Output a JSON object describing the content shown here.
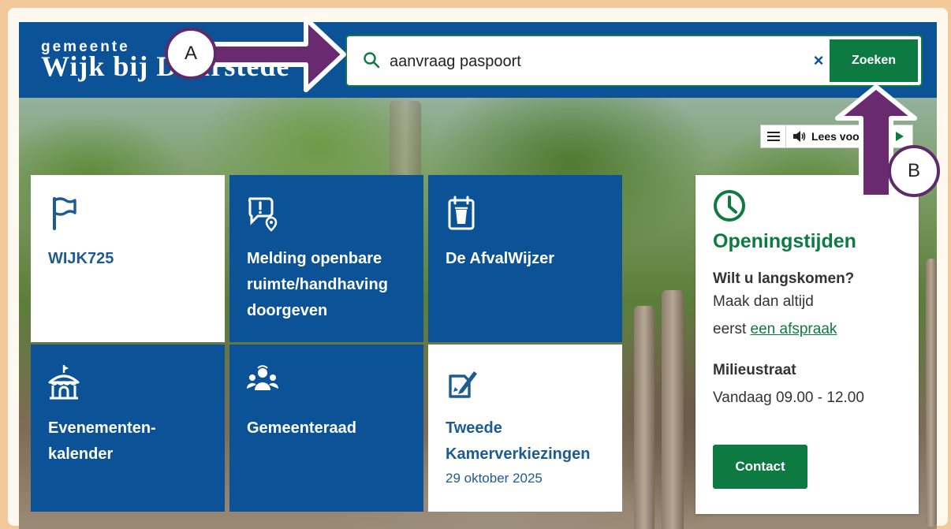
{
  "header": {
    "logo_small": "gemeente",
    "logo_main": "Wijk bij Duurstede",
    "search_value": "aanvraag paspoort",
    "clear_symbol": "×",
    "search_button": "Zoeken"
  },
  "readspeaker": {
    "label": "Lees voor"
  },
  "tiles": [
    {
      "label": "WIJK725",
      "icon": "flag-icon"
    },
    {
      "label": "Melding openbare\nruimte/handhaving\ndoorgeven",
      "icon": "report-location-icon"
    },
    {
      "label": "De AfvalWijzer",
      "icon": "waste-calendar-icon"
    },
    {
      "label": "Evenementen-\nkalender",
      "icon": "tent-icon"
    },
    {
      "label": "Gemeenteraad",
      "icon": "council-people-icon"
    },
    {
      "label": "Tweede\nKamerverkiezingen",
      "sub": "29 oktober 2025",
      "icon": "ballot-pen-icon"
    }
  ],
  "hours": {
    "title": "Openingstijden",
    "question": "Wilt u langskomen?",
    "line1": "Maak dan altijd",
    "line2_prefix": "eerst ",
    "line2_link": "een afspraak",
    "section": "Milieustraat",
    "today": "Vandaag 09.00 - 12.00",
    "contact_button": "Contact"
  },
  "annotations": {
    "a": "A",
    "b": "B"
  },
  "colors": {
    "brand_blue": "#0b5396",
    "brand_green": "#0d7a42",
    "annotation_purple": "#6a2a70"
  }
}
